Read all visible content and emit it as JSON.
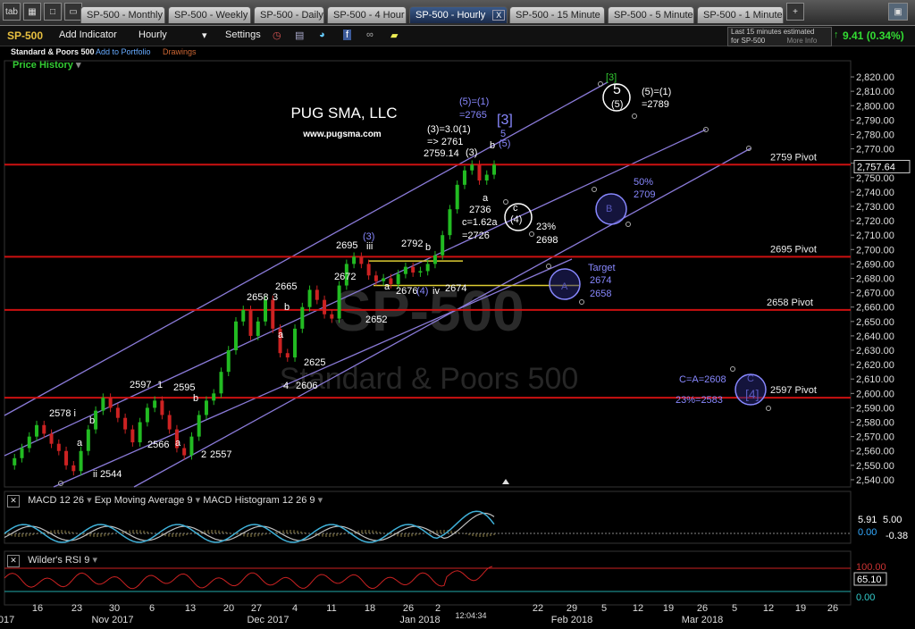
{
  "tabs": {
    "corner": "tab",
    "items": [
      {
        "label": "SP-500 - Monthly",
        "active": false
      },
      {
        "label": "SP-500 - Weekly",
        "active": false
      },
      {
        "label": "SP-500 - Daily",
        "active": false
      },
      {
        "label": "SP-500 - 4 Hour",
        "active": false
      },
      {
        "label": "SP-500 - Hourly",
        "active": true
      },
      {
        "label": "SP-500 - 15 Minute",
        "active": false
      },
      {
        "label": "SP-500 - 5 Minute",
        "active": false
      },
      {
        "label": "SP-500 - 1 Minute",
        "active": false
      }
    ],
    "close_glyph": "X"
  },
  "toolbar": {
    "symbol": "SP-500",
    "add_indicator": "Add Indicator",
    "interval": "Hourly",
    "settings": "Settings",
    "delay_notice_line1": "Last 15 minutes estimated",
    "delay_notice_line2": "for SP-500",
    "more_info": "More Info",
    "change": "9.41 (0.34%)"
  },
  "subheader": {
    "name": "Standard & Poors 500",
    "add_portfolio": "Add to Portfolio",
    "drawings": "Drawings",
    "price_history": "Price History"
  },
  "watermark": {
    "big": "SP-500",
    "name": "Standard & Poors 500"
  },
  "brand": {
    "name": "PUG SMA, LLC",
    "url": "www.pugsma.com"
  },
  "colors": {
    "up": "#22bb22",
    "down": "#cc2222",
    "pivot": "#cc1111",
    "channel": "#8a7ad8",
    "fib": "#ddcc33",
    "macd": "#3fb0d8",
    "signal": "#c0c0c0",
    "rsi": "#cc2222"
  },
  "chart_data": {
    "type": "line",
    "title": "SP-500 - Hourly",
    "ylim": [
      2530,
      2825
    ],
    "y_ticks": [
      "2,820.00",
      "2,810.00",
      "2,800.00",
      "2,790.00",
      "2,780.00",
      "2,770.00",
      "2,760.00",
      "2,750.00",
      "2,740.00",
      "2,730.00",
      "2,720.00",
      "2,710.00",
      "2,700.00",
      "2,690.00",
      "2,680.00",
      "2,670.00",
      "2,660.00",
      "2,650.00",
      "2,640.00",
      "2,630.00",
      "2,620.00",
      "2,610.00",
      "2,600.00",
      "2,590.00",
      "2,580.00",
      "2,570.00",
      "2,560.00",
      "2,550.00",
      "2,540.00"
    ],
    "last_price": "2,757.64",
    "x_labels": [
      "2017",
      "16",
      "23",
      "30",
      "Nov 2017",
      "6",
      "13",
      "20",
      "27",
      "Dec 2017",
      "4",
      "11",
      "18",
      "26",
      "Jan 2018",
      "2",
      "12:04:34",
      "22",
      "29",
      "Feb 2018",
      "5",
      "12",
      "19",
      "26",
      "Mar 2018",
      "5",
      "12",
      "19",
      "26"
    ],
    "series": [
      {
        "values": [
          2550,
          2555,
          2562,
          2570,
          2578,
          2572,
          2565,
          2560,
          2550,
          2546,
          2560,
          2575,
          2588,
          2597,
          2590,
          2583,
          2575,
          2566,
          2580,
          2590,
          2595,
          2585,
          2575,
          2562,
          2557,
          2570,
          2585,
          2595,
          2600,
          2615,
          2630,
          2650,
          2658,
          2640,
          2650,
          2665,
          2645,
          2628,
          2625,
          2645,
          2660,
          2672,
          2665,
          2655,
          2652,
          2675,
          2690,
          2695,
          2690,
          2682,
          2678,
          2680,
          2676,
          2683,
          2688,
          2684,
          2685,
          2690,
          2696,
          2710,
          2728,
          2745,
          2755,
          2759,
          2748,
          2752,
          2759
        ]
      }
    ],
    "pivots": [
      {
        "label": "2759 Pivot",
        "value": 2759
      },
      {
        "label": "2695 Pivot",
        "value": 2695
      },
      {
        "label": "2658 Pivot",
        "value": 2658
      },
      {
        "label": "2597 Pivot",
        "value": 2597
      }
    ],
    "annotations": [
      {
        "text": "2578 i"
      },
      {
        "text": "b"
      },
      {
        "text": "a"
      },
      {
        "text": "ii 2544"
      },
      {
        "text": "2597"
      },
      {
        "text": "1"
      },
      {
        "text": "2595"
      },
      {
        "text": "b"
      },
      {
        "text": "2566"
      },
      {
        "text": "a"
      },
      {
        "text": "2"
      },
      {
        "text": "2557"
      },
      {
        "text": "2658"
      },
      {
        "text": "3"
      },
      {
        "text": "2665"
      },
      {
        "text": "b"
      },
      {
        "text": "a"
      },
      {
        "text": "2625"
      },
      {
        "text": "4"
      },
      {
        "text": "2606"
      },
      {
        "text": "2672"
      },
      {
        "text": "2652"
      },
      {
        "text": "2695"
      },
      {
        "text": "(3)"
      },
      {
        "text": "iii"
      },
      {
        "text": "2792"
      },
      {
        "text": "b"
      },
      {
        "text": "a"
      },
      {
        "text": "2676"
      },
      {
        "text": "(4)"
      },
      {
        "text": "iv"
      },
      {
        "text": "2674"
      },
      {
        "text": "(3)=3.0(1)"
      },
      {
        "text": "=> 2761"
      },
      {
        "text": "2759.14"
      },
      {
        "text": "(3)"
      },
      {
        "text": "(5)=(1)"
      },
      {
        "text": "=2765"
      },
      {
        "text": "[3]"
      },
      {
        "text": "5"
      },
      {
        "text": "(5)"
      },
      {
        "text": "b"
      },
      {
        "text": "a"
      },
      {
        "text": "2736"
      },
      {
        "text": "c=1.62a"
      },
      {
        "text": "=2726"
      },
      {
        "text": "c"
      },
      {
        "text": "(4)"
      },
      {
        "text": "23%"
      },
      {
        "text": "2698"
      },
      {
        "text": "50%"
      },
      {
        "text": "2709"
      },
      {
        "text": "B"
      },
      {
        "text": "Target"
      },
      {
        "text": "2674"
      },
      {
        "text": "2658"
      },
      {
        "text": "A"
      },
      {
        "text": "C=A=2608"
      },
      {
        "text": "23%=2583"
      },
      {
        "text": "C"
      },
      {
        "text": "[4]"
      },
      {
        "text": "[3]"
      },
      {
        "text": "5"
      },
      {
        "text": "(5)"
      },
      {
        "text": "(5)=(1)"
      },
      {
        "text": "=2789"
      }
    ]
  },
  "macd": {
    "label": "MACD 12 26",
    "ema": "Exp Moving Average 9",
    "hist": "MACD Histogram 12 26 9",
    "val1": "5.91",
    "val2": "5.00",
    "val3": "0.00",
    "val4": "-0.38"
  },
  "rsi": {
    "label": "Wilder's RSI 9",
    "top": "100.00",
    "val": "65.10",
    "bottom": "0.00"
  }
}
